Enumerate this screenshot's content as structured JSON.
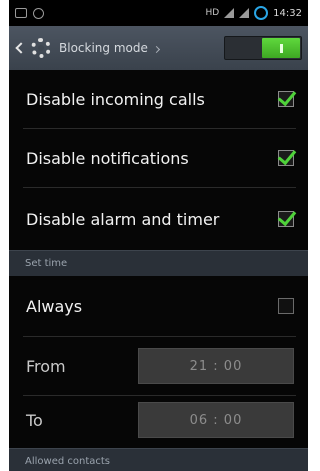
{
  "status_bar": {
    "network_text": "HD",
    "time": "14:32"
  },
  "action_bar": {
    "title": "Blocking mode"
  },
  "options": [
    {
      "label": "Disable incoming calls",
      "checked": true
    },
    {
      "label": "Disable notifications",
      "checked": true
    },
    {
      "label": "Disable alarm and timer",
      "checked": true
    }
  ],
  "set_time": {
    "section_label": "Set time",
    "always_label": "Always",
    "always_checked": false,
    "from_label": "From",
    "from_value": "21 : 00",
    "to_label": "To",
    "to_value": "06 : 00"
  },
  "allowed_contacts": {
    "section_label": "Allowed contacts"
  },
  "colors": {
    "accent_green": "#4fd23a",
    "action_bar": "#434b55",
    "section_bg": "#2a3038"
  }
}
